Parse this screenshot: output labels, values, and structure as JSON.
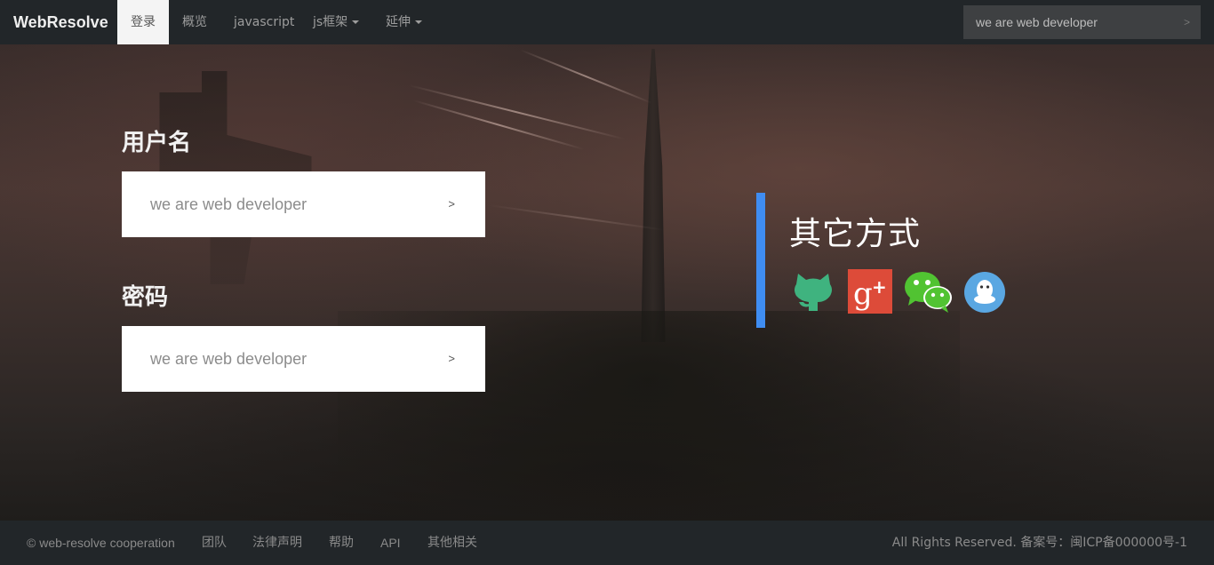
{
  "navbar": {
    "brand": "WebResolve",
    "items": [
      {
        "label": "登录",
        "active": true
      },
      {
        "label": "概览"
      },
      {
        "label": "javascript"
      },
      {
        "label": "js框架",
        "dropdown": true
      },
      {
        "label": "延伸",
        "dropdown": true
      }
    ],
    "search": {
      "placeholder": "we are web developer",
      "button": ">"
    }
  },
  "form": {
    "username_label": "用户名",
    "username_placeholder": "we are web developer",
    "username_button": ">",
    "password_label": "密码",
    "password_placeholder": "we are web developer",
    "password_button": ">"
  },
  "other_login": {
    "title": "其它方式",
    "accent_color": "#3f8df2",
    "icons": [
      "github-icon",
      "google-plus-icon",
      "wechat-icon",
      "qq-icon"
    ]
  },
  "footer": {
    "copyright": "© web-resolve cooperation",
    "links": [
      "团队",
      "法律声明",
      "帮助",
      "API",
      "其他相关"
    ],
    "rights": "All Rights Reserved. 备案号：闽ICP备000000号-1"
  },
  "colors": {
    "navbar_bg": "#222629",
    "github": "#3fb37f",
    "google_plus": "#dd4b39",
    "wechat": "#51c332",
    "qq": "#5aa7e2"
  }
}
